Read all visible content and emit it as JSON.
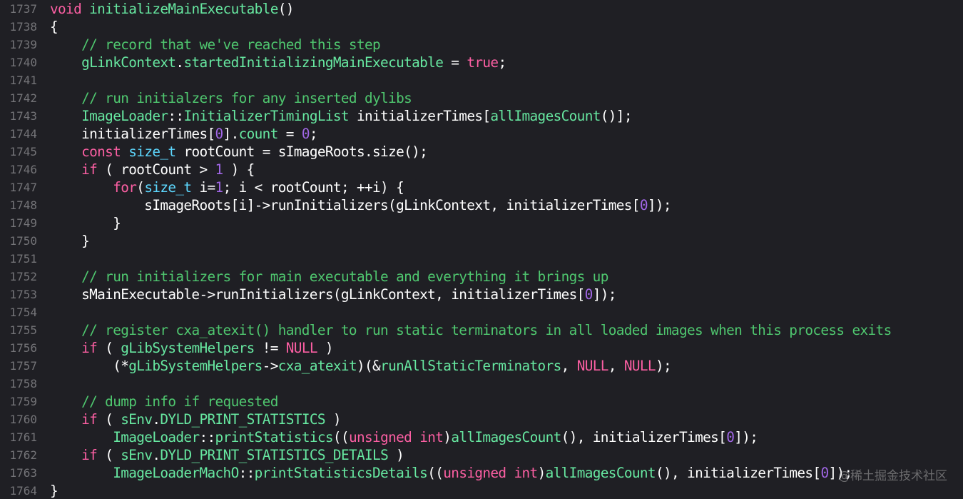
{
  "editor": {
    "lines": [
      {
        "num": "1737",
        "tokens": [
          [
            "k",
            "void"
          ],
          [
            "pl",
            " "
          ],
          [
            "fn",
            "initializeMainExecutable"
          ],
          [
            "pl",
            "()"
          ]
        ]
      },
      {
        "num": "1738",
        "tokens": [
          [
            "pl",
            "{"
          ]
        ]
      },
      {
        "num": "1739",
        "tokens": [
          [
            "pl",
            "    "
          ],
          [
            "cm",
            "// record that we've reached this step"
          ]
        ]
      },
      {
        "num": "1740",
        "tokens": [
          [
            "pl",
            "    "
          ],
          [
            "fn",
            "gLinkContext"
          ],
          [
            "pl",
            "."
          ],
          [
            "fn",
            "startedInitializingMainExecutable"
          ],
          [
            "pl",
            " = "
          ],
          [
            "k",
            "true"
          ],
          [
            "pl",
            ";"
          ]
        ]
      },
      {
        "num": "1741",
        "tokens": []
      },
      {
        "num": "1742",
        "tokens": [
          [
            "pl",
            "    "
          ],
          [
            "cm",
            "// run initialzers for any inserted dylibs"
          ]
        ]
      },
      {
        "num": "1743",
        "tokens": [
          [
            "pl",
            "    "
          ],
          [
            "fn",
            "ImageLoader"
          ],
          [
            "pl",
            "::"
          ],
          [
            "fn",
            "InitializerTimingList"
          ],
          [
            "pl",
            " initializerTimes["
          ],
          [
            "fn",
            "allImagesCount"
          ],
          [
            "pl",
            "()];"
          ]
        ]
      },
      {
        "num": "1744",
        "tokens": [
          [
            "pl",
            "    initializerTimes["
          ],
          [
            "n",
            "0"
          ],
          [
            "pl",
            "]."
          ],
          [
            "fn",
            "count"
          ],
          [
            "pl",
            " = "
          ],
          [
            "n",
            "0"
          ],
          [
            "pl",
            ";"
          ]
        ]
      },
      {
        "num": "1745",
        "tokens": [
          [
            "pl",
            "    "
          ],
          [
            "k",
            "const"
          ],
          [
            "pl",
            " "
          ],
          [
            "t",
            "size_t"
          ],
          [
            "pl",
            " rootCount = sImageRoots.size();"
          ]
        ]
      },
      {
        "num": "1746",
        "tokens": [
          [
            "pl",
            "    "
          ],
          [
            "k",
            "if"
          ],
          [
            "pl",
            " ( rootCount > "
          ],
          [
            "n",
            "1"
          ],
          [
            "pl",
            " ) {"
          ]
        ]
      },
      {
        "num": "1747",
        "tokens": [
          [
            "pl",
            "        "
          ],
          [
            "k",
            "for"
          ],
          [
            "pl",
            "("
          ],
          [
            "t",
            "size_t"
          ],
          [
            "pl",
            " i="
          ],
          [
            "n",
            "1"
          ],
          [
            "pl",
            "; i < rootCount; ++i) {"
          ]
        ]
      },
      {
        "num": "1748",
        "tokens": [
          [
            "pl",
            "            sImageRoots[i]->runInitializers(gLinkContext, initializerTimes["
          ],
          [
            "n",
            "0"
          ],
          [
            "pl",
            "]);"
          ]
        ]
      },
      {
        "num": "1749",
        "tokens": [
          [
            "pl",
            "        }"
          ]
        ]
      },
      {
        "num": "1750",
        "tokens": [
          [
            "pl",
            "    }"
          ]
        ]
      },
      {
        "num": "1751",
        "tokens": []
      },
      {
        "num": "1752",
        "tokens": [
          [
            "pl",
            "    "
          ],
          [
            "cm",
            "// run initializers for main executable and everything it brings up"
          ]
        ]
      },
      {
        "num": "1753",
        "tokens": [
          [
            "pl",
            "    sMainExecutable->runInitializers(gLinkContext, initializerTimes["
          ],
          [
            "n",
            "0"
          ],
          [
            "pl",
            "]);"
          ]
        ]
      },
      {
        "num": "1754",
        "tokens": []
      },
      {
        "num": "1755",
        "tokens": [
          [
            "pl",
            "    "
          ],
          [
            "cm",
            "// register cxa_atexit() handler to run static terminators in all loaded images when this process exits"
          ]
        ]
      },
      {
        "num": "1756",
        "tokens": [
          [
            "pl",
            "    "
          ],
          [
            "k",
            "if"
          ],
          [
            "pl",
            " ( "
          ],
          [
            "fn",
            "gLibSystemHelpers"
          ],
          [
            "pl",
            " != "
          ],
          [
            "k",
            "NULL"
          ],
          [
            "pl",
            " )"
          ]
        ]
      },
      {
        "num": "1757",
        "tokens": [
          [
            "pl",
            "        (*"
          ],
          [
            "fn",
            "gLibSystemHelpers"
          ],
          [
            "pl",
            "->"
          ],
          [
            "fn",
            "cxa_atexit"
          ],
          [
            "pl",
            ")(&"
          ],
          [
            "fn",
            "runAllStaticTerminators"
          ],
          [
            "pl",
            ", "
          ],
          [
            "k",
            "NULL"
          ],
          [
            "pl",
            ", "
          ],
          [
            "k",
            "NULL"
          ],
          [
            "pl",
            ");"
          ]
        ]
      },
      {
        "num": "1758",
        "tokens": []
      },
      {
        "num": "1759",
        "tokens": [
          [
            "pl",
            "    "
          ],
          [
            "cm",
            "// dump info if requested"
          ]
        ]
      },
      {
        "num": "1760",
        "tokens": [
          [
            "pl",
            "    "
          ],
          [
            "k",
            "if"
          ],
          [
            "pl",
            " ( "
          ],
          [
            "fn",
            "sEnv"
          ],
          [
            "pl",
            "."
          ],
          [
            "fn",
            "DYLD_PRINT_STATISTICS"
          ],
          [
            "pl",
            " )"
          ]
        ]
      },
      {
        "num": "1761",
        "tokens": [
          [
            "pl",
            "        "
          ],
          [
            "fn",
            "ImageLoader"
          ],
          [
            "pl",
            "::"
          ],
          [
            "fn",
            "printStatistics"
          ],
          [
            "pl",
            "(("
          ],
          [
            "k",
            "unsigned"
          ],
          [
            "pl",
            " "
          ],
          [
            "k",
            "int"
          ],
          [
            "pl",
            ")"
          ],
          [
            "fn",
            "allImagesCount"
          ],
          [
            "pl",
            "(), initializerTimes["
          ],
          [
            "n",
            "0"
          ],
          [
            "pl",
            "]);"
          ]
        ]
      },
      {
        "num": "1762",
        "tokens": [
          [
            "pl",
            "    "
          ],
          [
            "k",
            "if"
          ],
          [
            "pl",
            " ( "
          ],
          [
            "fn",
            "sEnv"
          ],
          [
            "pl",
            "."
          ],
          [
            "fn",
            "DYLD_PRINT_STATISTICS_DETAILS"
          ],
          [
            "pl",
            " )"
          ]
        ]
      },
      {
        "num": "1763",
        "tokens": [
          [
            "pl",
            "        "
          ],
          [
            "fn",
            "ImageLoaderMachO"
          ],
          [
            "pl",
            "::"
          ],
          [
            "fn",
            "printStatisticsDetails"
          ],
          [
            "pl",
            "(("
          ],
          [
            "k",
            "unsigned"
          ],
          [
            "pl",
            " "
          ],
          [
            "k",
            "int"
          ],
          [
            "pl",
            ")"
          ],
          [
            "fn",
            "allImagesCount"
          ],
          [
            "pl",
            "(), initializerTimes["
          ],
          [
            "n",
            "0"
          ],
          [
            "pl",
            "]);"
          ]
        ]
      },
      {
        "num": "1764",
        "tokens": [
          [
            "pl",
            "}"
          ]
        ]
      }
    ]
  },
  "watermark": {
    "text": "@稀土掘金技术社区"
  },
  "colors": {
    "background": "#1f1f24",
    "keyword": "#fc5fa3",
    "type": "#5dd8ff",
    "comment": "#4fc76f",
    "identifier": "#67e8a1",
    "number": "#a167e6",
    "plain": "#ffffff",
    "line_number": "#747478"
  }
}
